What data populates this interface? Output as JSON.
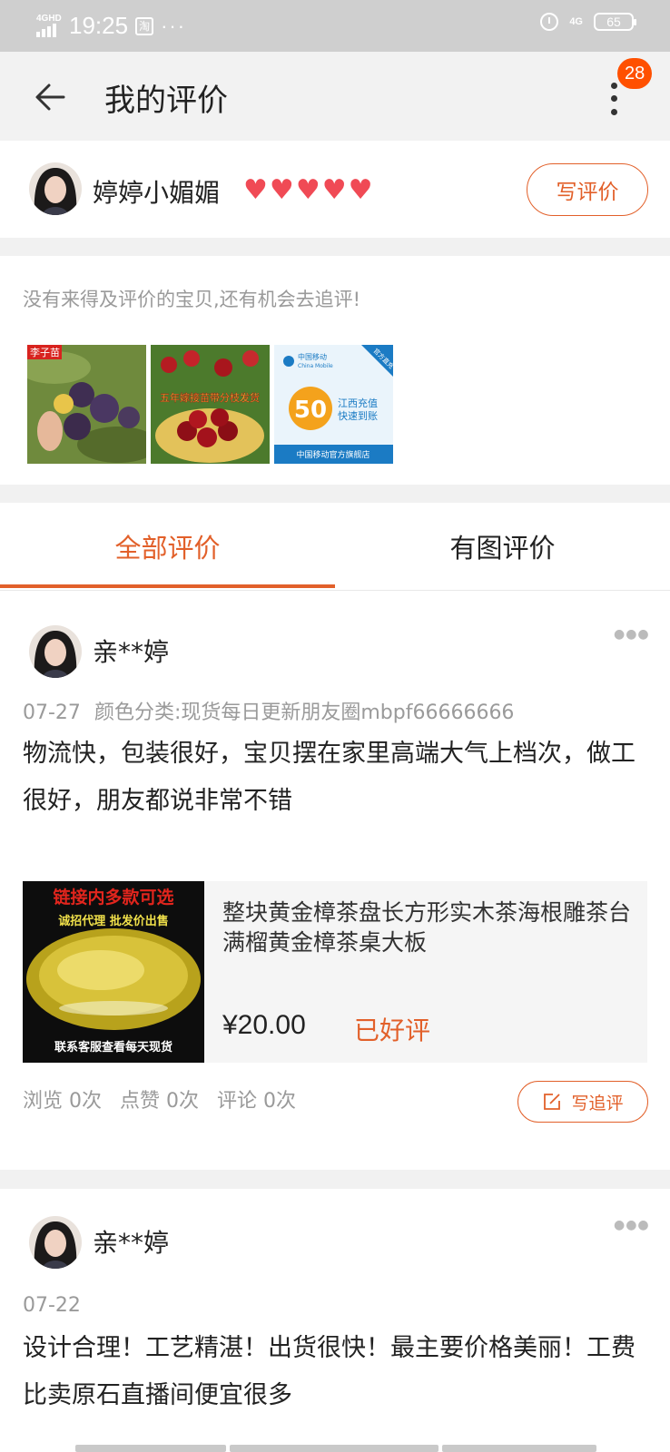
{
  "status_bar": {
    "network": "4GHD",
    "time": "19:25",
    "app_icon": "淘",
    "more": "···",
    "network_right": "4G",
    "battery": "65"
  },
  "header": {
    "title": "我的评价",
    "badge_count": "28"
  },
  "profile": {
    "name": "婷婷小媚媚",
    "hearts": [
      "♥",
      "♥",
      "♥",
      "♥",
      "♥"
    ],
    "write_review_label": "写评价"
  },
  "pending": {
    "hint": "没有来得及评价的宝贝,还有机会去追评!",
    "items": [
      {
        "badge": "李子苗"
      },
      {
        "caption": "五年嫁接苗带分枝发货"
      },
      {
        "brand": "中国移动",
        "brand_en": "China Mobile",
        "corner": "官方直充",
        "amount": "50",
        "line1": "江西充值",
        "line2": "快速到账",
        "footer": "中国移动官方旗舰店"
      }
    ]
  },
  "tabs": [
    {
      "label": "全部评价",
      "active": true
    },
    {
      "label": "有图评价",
      "active": false
    }
  ],
  "reviews": [
    {
      "user": "亲**婷",
      "date": "07-27",
      "spec": "颜色分类:现货每日更新朋友圈mbpf66666666",
      "text": " 物流快，包装很好，宝贝摆在家里高端大气上档次，做工很好，朋友都说非常不错",
      "product": {
        "title": "整块黄金樟茶盘长方形实木茶海根雕茶台满榴黄金樟茶桌大板",
        "price": "¥20.00",
        "status": "已好评",
        "image_top": "链接内多款可选",
        "image_mid": "诚招代理 批发价出售",
        "image_bottom": "联系客服查看每天现货"
      },
      "stats": [
        "浏览 0次",
        "点赞 0次",
        "评论 0次"
      ],
      "followup_label": "写追评"
    },
    {
      "user": "亲**婷",
      "date": "07-22",
      "text": "设计合理！工艺精湛！出货很快！最主要价格美丽！工费比卖原石直播间便宜很多"
    }
  ],
  "colors": {
    "accent": "#e2602a",
    "badge": "#ff5000",
    "heart": "#f04a55"
  }
}
